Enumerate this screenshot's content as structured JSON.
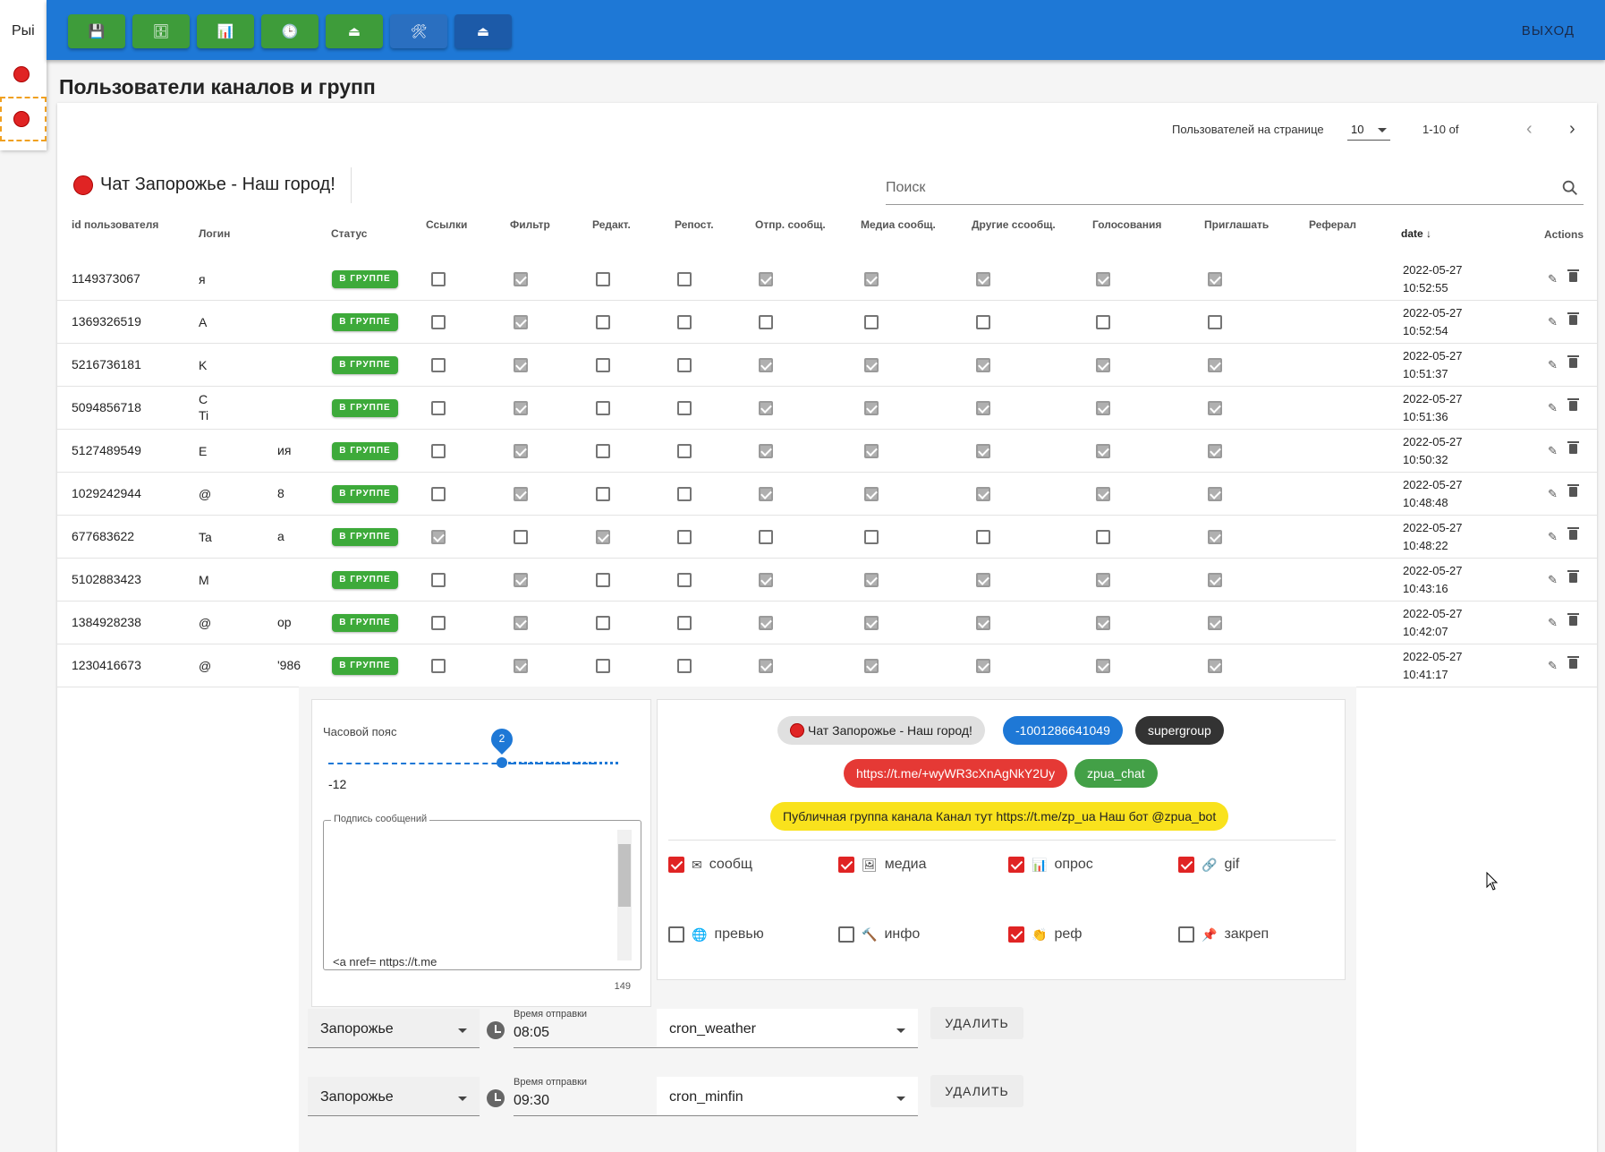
{
  "sidebar": {
    "label": "Рыі"
  },
  "topbar": {
    "buttons": [
      "💾",
      "🗄",
      "📊",
      "🕒",
      "⏏",
      "🛠",
      "⏏"
    ],
    "exit_label": "ВЫХОД"
  },
  "page_title": "Пользователи каналов и групп",
  "pagination": {
    "per_page_label": "Пользователей на странице",
    "per_page_value": "10",
    "range": "1-10 of"
  },
  "chat": {
    "title": "Чат Запорожье - Наш город!"
  },
  "search": {
    "placeholder": "Поиск"
  },
  "table": {
    "headers": [
      "id пользователя",
      "Логин",
      "Статус",
      "Ссылки",
      "Фильтр",
      "Редакт.",
      "Репост.",
      "Отпр. сообщ.",
      "Медиа сообщ.",
      "Другие ссообщ.",
      "Голосования",
      "Приглашать",
      "Реферал",
      "date",
      "Actions"
    ],
    "status_label": "В ГРУППЕ",
    "rows": [
      {
        "id": "1149373067",
        "login": "я",
        "login2": "",
        "perms": [
          false,
          true,
          false,
          false,
          true,
          true,
          true,
          true,
          true
        ],
        "date": "2022-05-27",
        "time": "10:52:55"
      },
      {
        "id": "1369326519",
        "login": "A",
        "login2": "",
        "perms": [
          false,
          true,
          false,
          false,
          false,
          false,
          false,
          false,
          false
        ],
        "date": "2022-05-27",
        "time": "10:52:54"
      },
      {
        "id": "5216736181",
        "login": "K",
        "login2": "",
        "perms": [
          false,
          true,
          false,
          false,
          true,
          true,
          true,
          true,
          true
        ],
        "date": "2022-05-27",
        "time": "10:51:37"
      },
      {
        "id": "5094856718",
        "login": "C\nTi",
        "login2": "",
        "perms": [
          false,
          true,
          false,
          false,
          true,
          true,
          true,
          true,
          true
        ],
        "date": "2022-05-27",
        "time": "10:51:36"
      },
      {
        "id": "5127489549",
        "login": "E",
        "login2": "ия",
        "perms": [
          false,
          true,
          false,
          false,
          true,
          true,
          true,
          true,
          true
        ],
        "date": "2022-05-27",
        "time": "10:50:32"
      },
      {
        "id": "1029242944",
        "login": "@",
        "login2": "8",
        "perms": [
          false,
          true,
          false,
          false,
          true,
          true,
          true,
          true,
          true
        ],
        "date": "2022-05-27",
        "time": "10:48:48"
      },
      {
        "id": "677683622",
        "login": "Ta",
        "login2": "a",
        "perms": [
          true,
          false,
          true,
          false,
          false,
          false,
          false,
          false,
          true
        ],
        "date": "2022-05-27",
        "time": "10:48:22"
      },
      {
        "id": "5102883423",
        "login": "M",
        "login2": "",
        "perms": [
          false,
          true,
          false,
          false,
          true,
          true,
          true,
          true,
          true
        ],
        "date": "2022-05-27",
        "time": "10:43:16"
      },
      {
        "id": "1384928238",
        "login": "@",
        "login2": "ор",
        "perms": [
          false,
          true,
          false,
          false,
          true,
          true,
          true,
          true,
          true
        ],
        "date": "2022-05-27",
        "time": "10:42:07"
      },
      {
        "id": "1230416673",
        "login": "@",
        "login2": "'986",
        "perms": [
          false,
          true,
          false,
          false,
          true,
          true,
          true,
          true,
          true
        ],
        "date": "2022-05-27",
        "time": "10:41:17"
      }
    ]
  },
  "timezone": {
    "label": "Часовой пояс",
    "value": "2",
    "min": "-12"
  },
  "signature": {
    "legend": "Подпись сообщений",
    "text": "<a nref= nttps://t.me",
    "count": "149"
  },
  "chips": {
    "chat": "Чат Запорожье - Наш город!",
    "id": "-1001286641049",
    "type": "supergroup",
    "link": "https://t.me/+wyWR3cXnAgNkY2Uy",
    "username": "zpua_chat",
    "desc": "Публичная группа канала Канал тут https://t.me/zp_ua Наш бот @zpua_bot"
  },
  "options": [
    {
      "label": "сообщ",
      "icon": "✉",
      "checked": true
    },
    {
      "label": "медиа",
      "icon": "🖼",
      "checked": true
    },
    {
      "label": "опрос",
      "icon": "📊",
      "checked": true
    },
    {
      "label": "gif",
      "icon": "🔗",
      "checked": true
    },
    {
      "label": "превью",
      "icon": "🌐",
      "checked": false
    },
    {
      "label": "инфо",
      "icon": "🔨",
      "checked": false
    },
    {
      "label": "реф",
      "icon": "👏",
      "checked": true
    },
    {
      "label": "закреп",
      "icon": "📌",
      "checked": false
    }
  ],
  "schedules": [
    {
      "city": "Запорожье",
      "time_label": "Время отправки",
      "time": "08:05",
      "job": "cron_weather",
      "delete_label": "УДАЛИТЬ"
    },
    {
      "city": "Запорожье",
      "time_label": "Время отправки",
      "time": "09:30",
      "job": "cron_minfin",
      "delete_label": "УДАЛИТЬ"
    }
  ],
  "colors": {
    "topbar": "#1e78d6",
    "green": "#3e9c3a",
    "red": "#e02424"
  }
}
